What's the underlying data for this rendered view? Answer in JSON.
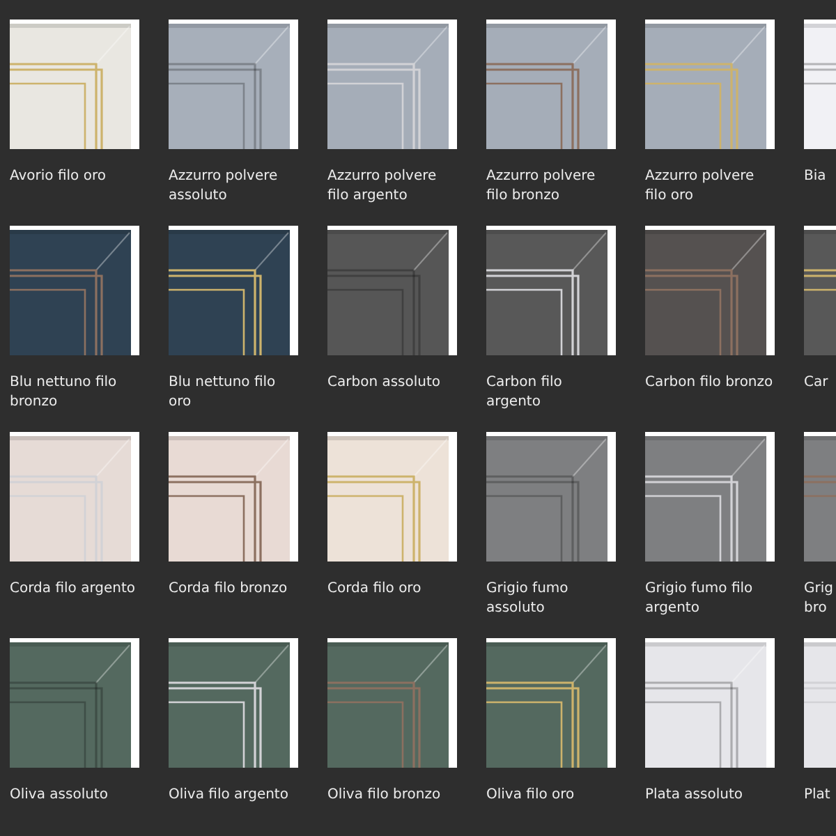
{
  "swatches": [
    {
      "label": "Avorio filo oro",
      "color": "#e9e7e1",
      "kind": "oro"
    },
    {
      "label": "Azzurro polvere assoluto",
      "color": "#a7afba",
      "kind": "assoluto"
    },
    {
      "label": "Azzurro polvere filo argento",
      "color": "#a5adb8",
      "kind": "argento"
    },
    {
      "label": "Azzurro polvere filo bronzo",
      "color": "#a5adb8",
      "kind": "bronzo"
    },
    {
      "label": "Azzurro polvere filo oro",
      "color": "#a5adb8",
      "kind": "oro"
    },
    {
      "label": "Bia",
      "color": "#f1f1f5",
      "kind": "assoluto"
    },
    {
      "label": "Blu nettuno filo bronzo",
      "color": "#2f4253",
      "kind": "bronzo"
    },
    {
      "label": "Blu nettuno filo oro",
      "color": "#2f4253",
      "kind": "oro"
    },
    {
      "label": "Carbon assoluto",
      "color": "#565656",
      "kind": "assoluto"
    },
    {
      "label": "Carbon filo argento",
      "color": "#585858",
      "kind": "argento"
    },
    {
      "label": "Carbon filo bronzo",
      "color": "#555150",
      "kind": "bronzo"
    },
    {
      "label": "Car",
      "color": "#585858",
      "kind": "oro"
    },
    {
      "label": "Corda filo argento",
      "color": "#e6dbd6",
      "kind": "argento"
    },
    {
      "label": "Corda filo bronzo",
      "color": "#e8dad4",
      "kind": "bronzo"
    },
    {
      "label": "Corda filo oro",
      "color": "#ede2d8",
      "kind": "oro"
    },
    {
      "label": "Grigio fumo assoluto",
      "color": "#7e7f81",
      "kind": "assoluto"
    },
    {
      "label": "Grigio fumo filo argento",
      "color": "#7e7f81",
      "kind": "argento"
    },
    {
      "label": "Grig bro",
      "color": "#7e7f81",
      "kind": "bronzo"
    },
    {
      "label": "Oliva assoluto",
      "color": "#54695f",
      "kind": "assoluto"
    },
    {
      "label": "Oliva filo argento",
      "color": "#54695f",
      "kind": "argento"
    },
    {
      "label": "Oliva filo bronzo",
      "color": "#54695f",
      "kind": "bronzo"
    },
    {
      "label": "Oliva filo oro",
      "color": "#54695f",
      "kind": "oro"
    },
    {
      "label": "Plata assoluto",
      "color": "#e6e6ea",
      "kind": "assoluto"
    },
    {
      "label": "Plat",
      "color": "#e6e6ea",
      "kind": "argento"
    }
  ]
}
